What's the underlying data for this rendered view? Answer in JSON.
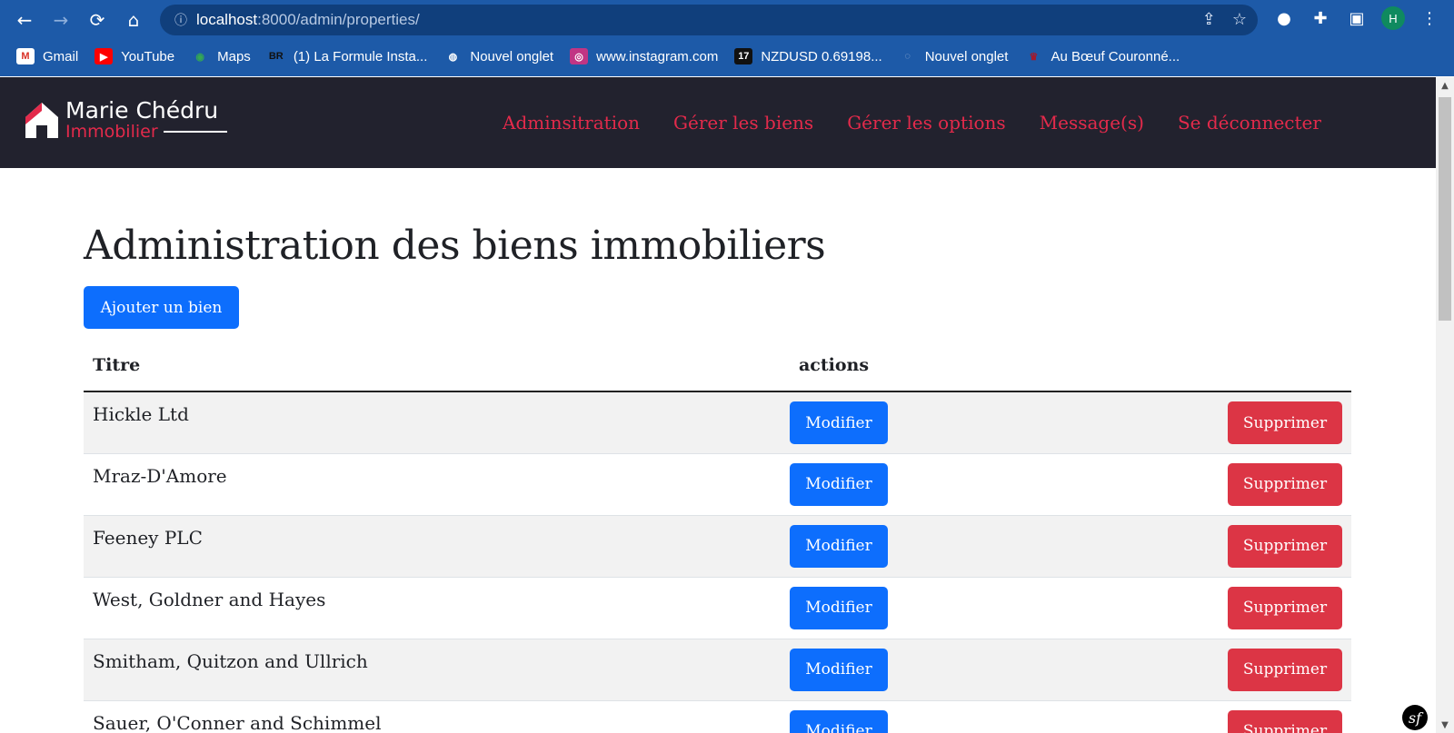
{
  "browser": {
    "url_host": "localhost",
    "url_path": ":8000/admin/properties/",
    "avatar_letter": "H",
    "bookmarks": [
      {
        "icon": "gmail-icon",
        "label": "Gmail"
      },
      {
        "icon": "youtube-icon",
        "label": "YouTube"
      },
      {
        "icon": "maps-icon",
        "label": "Maps"
      },
      {
        "icon": "br-icon",
        "label": "(1) La Formule Insta..."
      },
      {
        "icon": "globe-icon",
        "label": "Nouvel onglet"
      },
      {
        "icon": "instagram-icon",
        "label": "www.instagram.com"
      },
      {
        "icon": "tradingview-icon",
        "label": "NZDUSD 0.69198..."
      },
      {
        "icon": "tab-icon",
        "label": "Nouvel onglet"
      },
      {
        "icon": "restaurant-icon",
        "label": "Au Bœuf Couronné..."
      }
    ]
  },
  "site": {
    "logo_name": "Marie Chédru",
    "logo_sub": "Immobilier",
    "nav": [
      "Adminsitration",
      "Gérer les biens",
      "Gérer les options",
      "Message(s)",
      "Se déconnecter"
    ]
  },
  "main": {
    "title": "Administration des biens immobiliers",
    "add_button": "Ajouter un bien",
    "columns": [
      "Titre",
      "actions"
    ],
    "rows": [
      {
        "title": "Hickle Ltd",
        "edit": "Modifier",
        "delete": "Supprimer"
      },
      {
        "title": "Mraz-D'Amore",
        "edit": "Modifier",
        "delete": "Supprimer"
      },
      {
        "title": "Feeney PLC",
        "edit": "Modifier",
        "delete": "Supprimer"
      },
      {
        "title": "West, Goldner and Hayes",
        "edit": "Modifier",
        "delete": "Supprimer"
      },
      {
        "title": "Smitham, Quitzon and Ullrich",
        "edit": "Modifier",
        "delete": "Supprimer"
      },
      {
        "title": "Sauer, O'Conner and Schimmel",
        "edit": "Modifier",
        "delete": "Supprimer"
      }
    ]
  },
  "colors": {
    "chrome": "#1d5aa8",
    "navbar": "#22222e",
    "accent": "#e32a4b",
    "primary": "#0d6efd",
    "danger": "#dc3545"
  }
}
